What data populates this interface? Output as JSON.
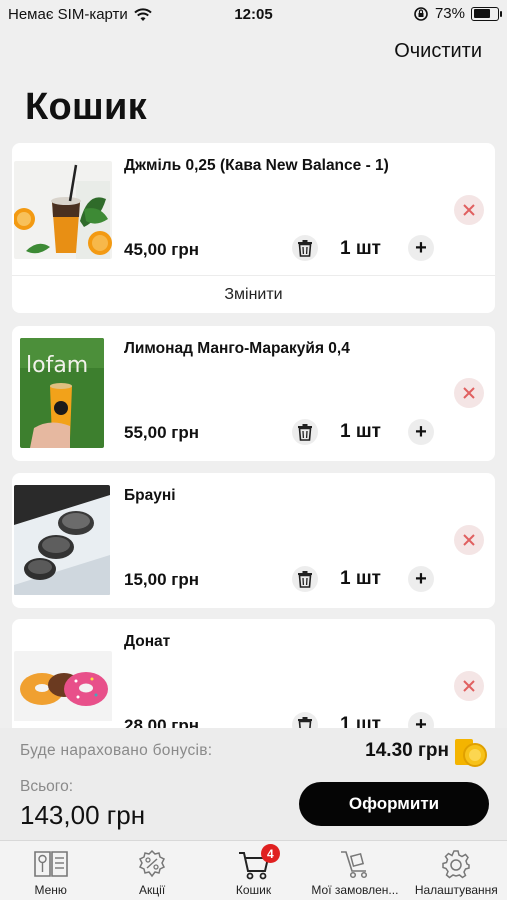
{
  "status_bar": {
    "carrier": "Немає SIM-карти",
    "time": "12:05",
    "battery": "73%",
    "battery_level": 0.73
  },
  "header": {
    "clear_label": "Очистити",
    "title": "Кошик"
  },
  "cart_items": [
    {
      "name": "Джміль 0,25 (Кава New Balance - 1)",
      "price": "45,00 грн",
      "qty": "1 шт",
      "change_label": "Змінити"
    },
    {
      "name": "Лимонад Манго-Маракуйя 0,4",
      "price": "55,00 грн",
      "qty": "1 шт"
    },
    {
      "name": "Брауні",
      "price": "15,00 грн",
      "qty": "1 шт"
    },
    {
      "name": "Донат",
      "price": "28,00 грн",
      "qty": "1 шт"
    }
  ],
  "summary": {
    "bonus_label": "Буде нараховано бонусів:",
    "bonus_value": "14.30 грн",
    "total_label": "Всього:",
    "total_value": "143,00 грн",
    "checkout_label": "Оформити"
  },
  "tabs": [
    {
      "label": "Меню",
      "icon": "menu-book-icon"
    },
    {
      "label": "Акції",
      "icon": "percent-badge-icon"
    },
    {
      "label": "Кошик",
      "icon": "cart-icon",
      "badge": "4"
    },
    {
      "label": "Мої замовлен...",
      "icon": "delivery-cart-icon"
    },
    {
      "label": "Налаштування",
      "icon": "gear-icon"
    }
  ],
  "colors": {
    "accent_dark": "#050505",
    "badge_red": "#e02020",
    "remove_red": "#e06060",
    "coin_gold": "#f4b400"
  }
}
